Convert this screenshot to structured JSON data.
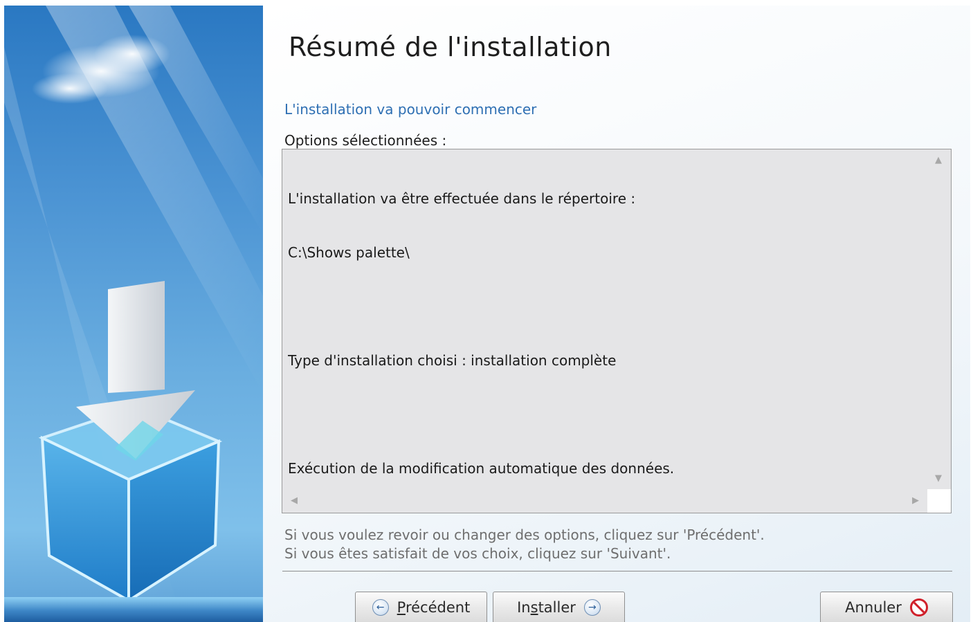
{
  "header": {
    "title": "Résumé de l'installation",
    "subtitle": "L'installation va pouvoir commencer"
  },
  "options": {
    "label": "Options sélectionnées :",
    "lines": [
      "L'installation va être effectuée dans le répertoire :",
      "C:\\Shows palette\\",
      "",
      "Type d'installation choisi : installation complète",
      "",
      "Exécution de la modification automatique des données."
    ]
  },
  "hint": {
    "line1": "Si vous voulez revoir ou changer des options, cliquez sur 'Précédent'.",
    "line2": "Si vous êtes satisfait de vos choix, cliquez sur 'Suivant'."
  },
  "buttons": {
    "previous": {
      "prefix": "",
      "accel": "P",
      "rest": "récédent"
    },
    "install": {
      "prefix": "In",
      "accel": "s",
      "rest": "taller"
    },
    "cancel": {
      "label": "Annuler"
    }
  },
  "icons": {
    "previous": "arrow-left-circle-icon",
    "install": "arrow-right-circle-icon",
    "cancel": "cancel-prohibited-icon",
    "illustration": "install-box-arrow-illustration"
  },
  "colors": {
    "subtitle": "#2e6fb3",
    "cancel": "#d0202a",
    "panel_blue": "#4b93d3"
  }
}
